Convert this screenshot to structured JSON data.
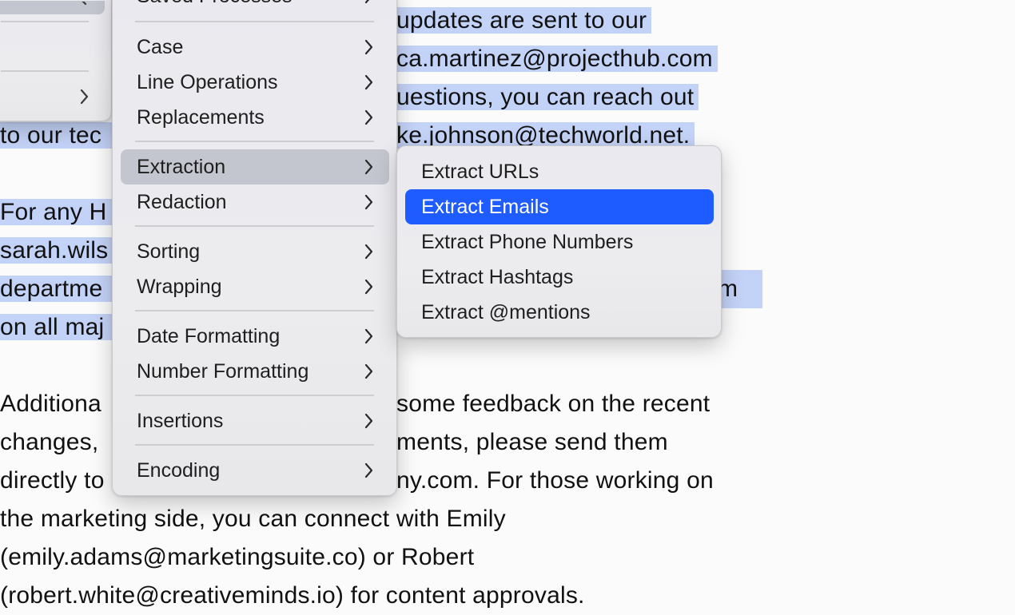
{
  "document": {
    "lines": [
      {
        "text": "updates are sent to our",
        "selected": true
      },
      {
        "text": "ca.martinez@projecthub.com",
        "selected": true
      },
      {
        "text": "uestions, you can reach out",
        "selected": true
      },
      {
        "text": "to our tec",
        "selected": true
      },
      {
        "text": "ke.johnson@techworld.net.",
        "selected": true
      },
      {
        "text": "For any H",
        "selected": true
      },
      {
        "text": "sarah.wils",
        "selected": true
      },
      {
        "text": "departme",
        "selected": true
      },
      {
        "text": "m",
        "selected": true
      },
      {
        "text": "on all maj",
        "selected": true
      },
      {
        "text": "Additiona",
        "selected": false
      },
      {
        "text": "some feedback on the recent",
        "selected": false
      },
      {
        "text": "changes,",
        "selected": false
      },
      {
        "text": "ments, please send them",
        "selected": false
      },
      {
        "text": "directly to",
        "selected": false
      },
      {
        "text": "ny.com. For those working on",
        "selected": false
      },
      {
        "text": "the marketing side, you can connect with Emily",
        "selected": false
      },
      {
        "text": "(emily.adams@marketingsuite.co) or Robert",
        "selected": false
      },
      {
        "text": "(robert.white@creativeminds.io) for content approvals.",
        "selected": false
      }
    ]
  },
  "main_menu": {
    "items": [
      {
        "label": "Saved Processes"
      },
      {
        "label": "Case"
      },
      {
        "label": "Line Operations"
      },
      {
        "label": "Replacements"
      },
      {
        "label": "Extraction"
      },
      {
        "label": "Redaction"
      },
      {
        "label": "Sorting"
      },
      {
        "label": "Wrapping"
      },
      {
        "label": "Date Formatting"
      },
      {
        "label": "Number Formatting"
      },
      {
        "label": "Insertions"
      },
      {
        "label": "Encoding"
      }
    ]
  },
  "submenu": {
    "items": [
      {
        "label": "Extract URLs"
      },
      {
        "label": "Extract Emails"
      },
      {
        "label": "Extract Phone Numbers"
      },
      {
        "label": "Extract Hashtags"
      },
      {
        "label": "Extract @mentions"
      }
    ]
  },
  "icons": {
    "chevron": "chevron-right-icon"
  },
  "colors": {
    "selection": "#c3d2f7",
    "menu_active": "#1f5cff",
    "menu_hover": "#c4c6cf"
  }
}
